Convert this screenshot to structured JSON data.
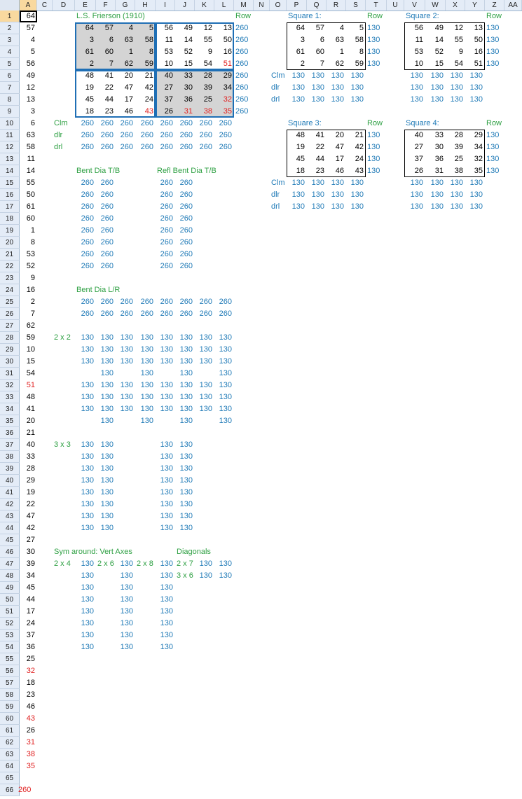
{
  "columns": [
    "A",
    "C",
    "D",
    "E",
    "F",
    "G",
    "H",
    "I",
    "J",
    "K",
    "L",
    "M",
    "N",
    "O",
    "P",
    "Q",
    "R",
    "S",
    "T",
    "U",
    "V",
    "W",
    "X",
    "Y",
    "Z",
    "AA"
  ],
  "rows": [
    "1",
    "2",
    "3",
    "4",
    "5",
    "6",
    "7",
    "8",
    "9",
    "10",
    "11",
    "12",
    "13",
    "14",
    "15",
    "16",
    "17",
    "18",
    "19",
    "20",
    "21",
    "22",
    "23",
    "24",
    "25",
    "26",
    "27",
    "28",
    "29",
    "30",
    "31",
    "32",
    "33",
    "34",
    "35",
    "36",
    "37",
    "38",
    "39",
    "40",
    "41",
    "42",
    "43",
    "44",
    "45",
    "46",
    "47",
    "48",
    "49",
    "50",
    "51",
    "52",
    "53",
    "54",
    "55",
    "56",
    "57",
    "58",
    "59",
    "60",
    "61",
    "62",
    "63",
    "64",
    "65",
    "66"
  ],
  "col_a": [
    "64",
    "57",
    "4",
    "5",
    "56",
    "49",
    "12",
    "13",
    "3",
    "6",
    "63",
    "58",
    "11",
    "14",
    "55",
    "50",
    "61",
    "60",
    "1",
    "8",
    "53",
    "52",
    "9",
    "16",
    "2",
    "7",
    "62",
    "59",
    "10",
    "15",
    "54",
    "51",
    "48",
    "41",
    "20",
    "21",
    "40",
    "33",
    "28",
    "29",
    "19",
    "22",
    "47",
    "42",
    "27",
    "30",
    "39",
    "34",
    "45",
    "44",
    "17",
    "24",
    "37",
    "36",
    "25",
    "32",
    "18",
    "23",
    "46",
    "43",
    "26",
    "31",
    "38",
    "35",
    "",
    "260"
  ],
  "col_a_red_rows": [
    32,
    56,
    60,
    62,
    63,
    64,
    66
  ],
  "frierson": {
    "title": "L.S. Frierson (1910)",
    "row_label": "Row",
    "grid": [
      [
        "64",
        "57",
        "4",
        "5",
        "56",
        "49",
        "12",
        "13"
      ],
      [
        "3",
        "6",
        "63",
        "58",
        "11",
        "14",
        "55",
        "50"
      ],
      [
        "61",
        "60",
        "1",
        "8",
        "53",
        "52",
        "9",
        "16"
      ],
      [
        "2",
        "7",
        "62",
        "59",
        "10",
        "15",
        "54",
        "51"
      ],
      [
        "48",
        "41",
        "20",
        "21",
        "40",
        "33",
        "28",
        "29"
      ],
      [
        "19",
        "22",
        "47",
        "42",
        "27",
        "30",
        "39",
        "34"
      ],
      [
        "45",
        "44",
        "17",
        "24",
        "37",
        "36",
        "25",
        "32"
      ],
      [
        "18",
        "23",
        "46",
        "43",
        "26",
        "31",
        "38",
        "35"
      ]
    ],
    "row_sums": [
      "260",
      "260",
      "260",
      "260",
      "260",
      "260",
      "260",
      "260"
    ],
    "labels": [
      "Clm",
      "dlr",
      "drl"
    ],
    "col_sums": [
      "260",
      "260",
      "260",
      "260",
      "260",
      "260",
      "260",
      "260"
    ]
  },
  "squares": [
    {
      "title": "Square 1:",
      "row_label": "Row",
      "grid": [
        [
          "64",
          "57",
          "4",
          "5"
        ],
        [
          "3",
          "6",
          "63",
          "58"
        ],
        [
          "61",
          "60",
          "1",
          "8"
        ],
        [
          "2",
          "7",
          "62",
          "59"
        ]
      ],
      "row_sums": [
        "130",
        "130",
        "130",
        "130"
      ],
      "labels": [
        "Clm",
        "dlr",
        "drl"
      ],
      "sums": [
        "130",
        "130",
        "130",
        "130"
      ]
    },
    {
      "title": "Square 2:",
      "row_label": "Row",
      "grid": [
        [
          "56",
          "49",
          "12",
          "13"
        ],
        [
          "11",
          "14",
          "55",
          "50"
        ],
        [
          "53",
          "52",
          "9",
          "16"
        ],
        [
          "10",
          "15",
          "54",
          "51"
        ]
      ],
      "row_sums": [
        "130",
        "130",
        "130",
        "130"
      ],
      "labels": [
        "",
        "",
        ""
      ],
      "sums": [
        "130",
        "130",
        "130",
        "130"
      ]
    },
    {
      "title": "Square 3:",
      "row_label": "Row",
      "grid": [
        [
          "48",
          "41",
          "20",
          "21"
        ],
        [
          "19",
          "22",
          "47",
          "42"
        ],
        [
          "45",
          "44",
          "17",
          "24"
        ],
        [
          "18",
          "23",
          "46",
          "43"
        ]
      ],
      "row_sums": [
        "130",
        "130",
        "130",
        "130"
      ],
      "labels": [
        "Clm",
        "dlr",
        "drl"
      ],
      "sums": [
        "130",
        "130",
        "130",
        "130"
      ]
    },
    {
      "title": "Square 4:",
      "row_label": "Row",
      "grid": [
        [
          "40",
          "33",
          "28",
          "29"
        ],
        [
          "27",
          "30",
          "39",
          "34"
        ],
        [
          "37",
          "36",
          "25",
          "32"
        ],
        [
          "26",
          "31",
          "38",
          "35"
        ]
      ],
      "row_sums": [
        "130",
        "130",
        "130",
        "130"
      ],
      "labels": [
        "",
        "",
        ""
      ],
      "sums": [
        "130",
        "130",
        "130",
        "130"
      ]
    }
  ],
  "bent_tb": {
    "title": "Bent Dia T/B",
    "value": "260"
  },
  "refl_bent_tb": {
    "title": "Refl Bent Dia T/B",
    "value": "260"
  },
  "bent_lr": {
    "title": "Bent Dia L/R",
    "value": "260"
  },
  "two_by_two": {
    "label": "2 x 2",
    "value": "130"
  },
  "three_by_three": {
    "label": "3 x 3",
    "value": "130"
  },
  "sym": {
    "title": "Sym around: Vert Axes",
    "diagonals": "Diagonals",
    "labels": [
      "2 x 4",
      "2 x 6",
      "2 x 8",
      "2 x 7",
      "3 x 6"
    ],
    "value": "130"
  }
}
